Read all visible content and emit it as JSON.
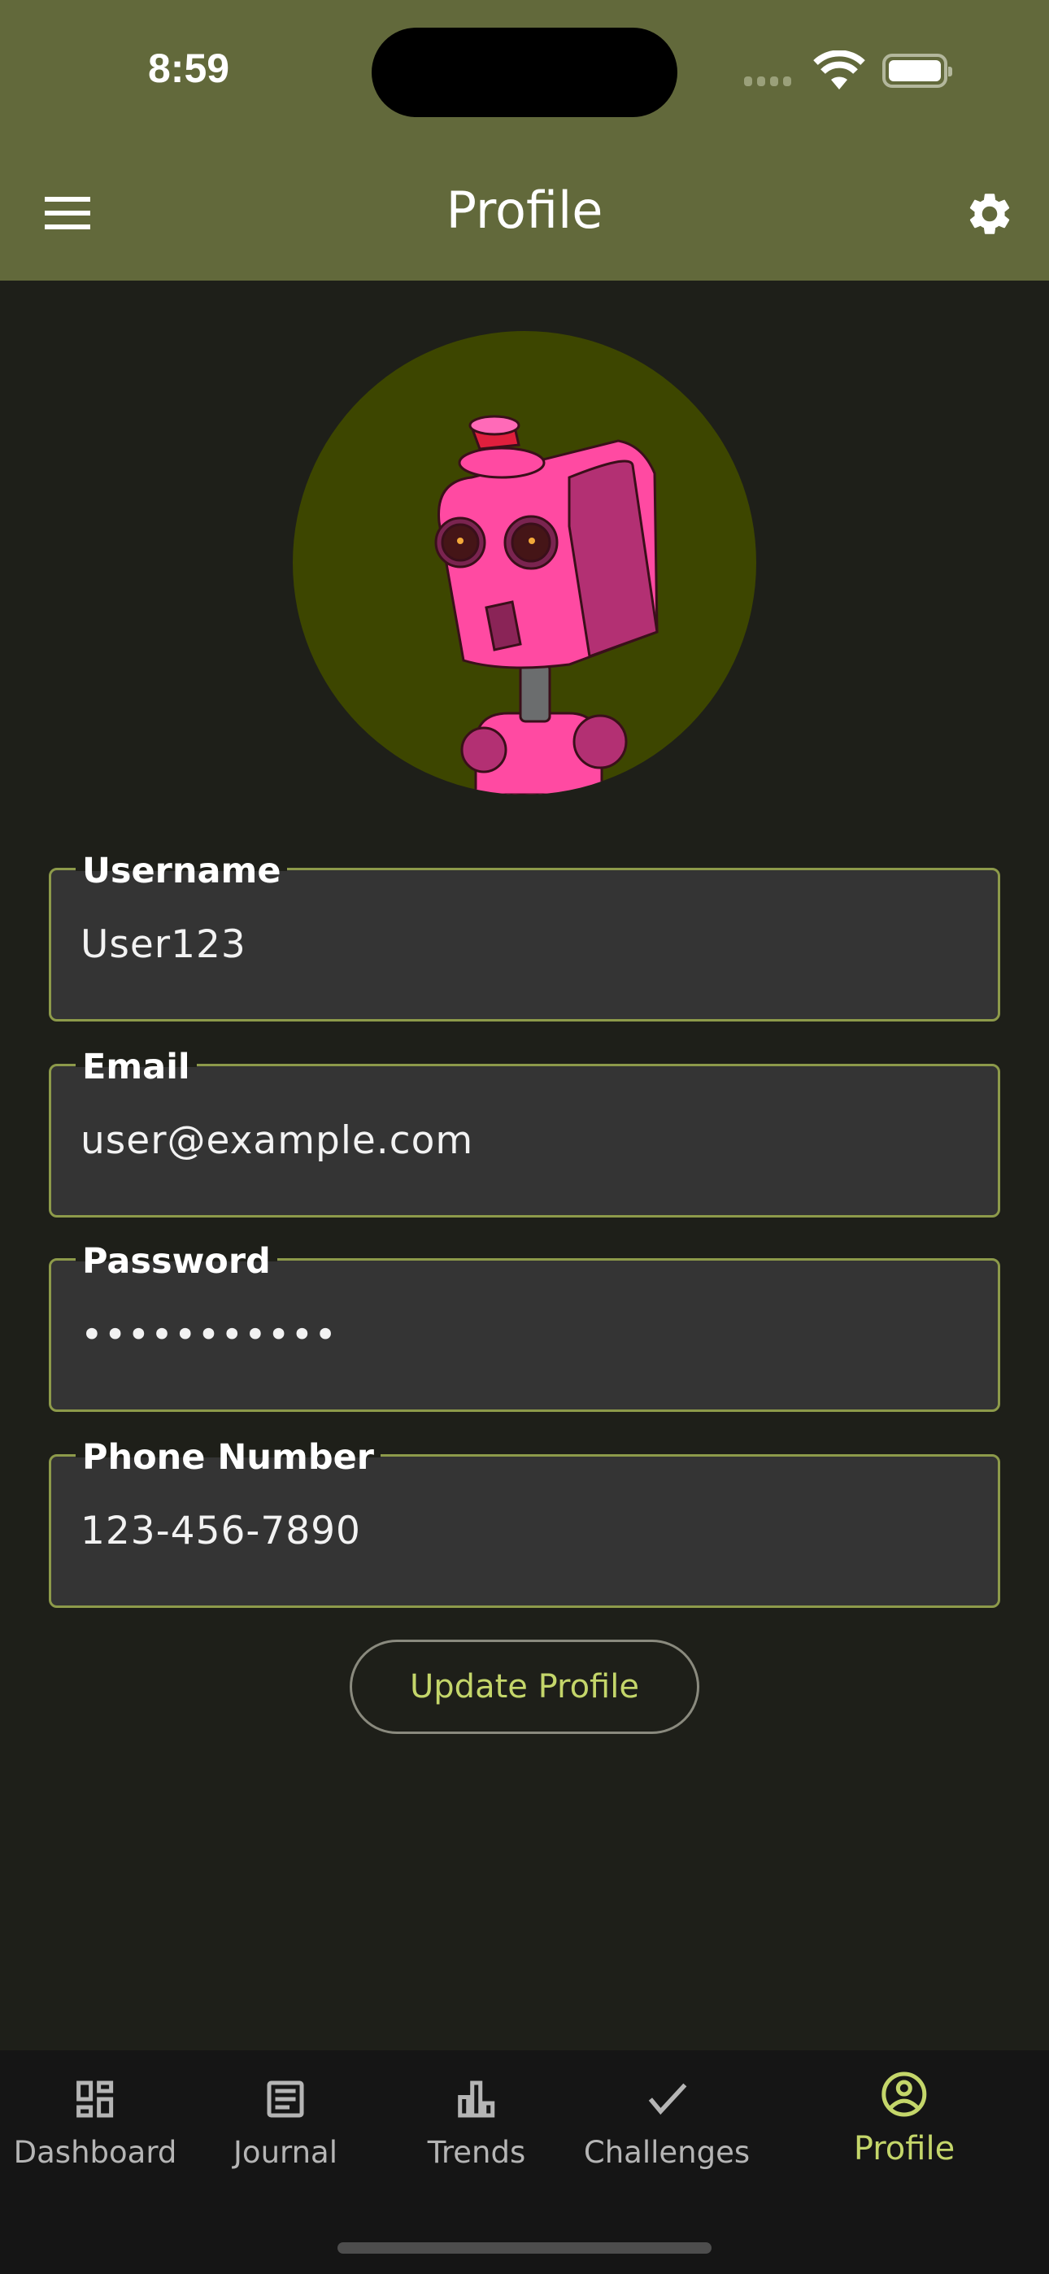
{
  "status_bar": {
    "time": "8:59"
  },
  "header": {
    "title": "Profile",
    "menu_icon": "hamburger-icon",
    "settings_icon": "gear-icon"
  },
  "avatar": {
    "description_icon": "robot-avatar"
  },
  "form": {
    "fields": [
      {
        "label": "Username",
        "value": "User123"
      },
      {
        "label": "Email",
        "value": "user@example.com"
      },
      {
        "label": "Password",
        "value": "•••••••••••"
      },
      {
        "label": "Phone Number",
        "value": "123-456-7890"
      }
    ],
    "submit_label": "Update Profile"
  },
  "nav": {
    "items": [
      {
        "label": "Dashboard",
        "icon": "dashboard-icon"
      },
      {
        "label": "Journal",
        "icon": "journal-icon"
      },
      {
        "label": "Trends",
        "icon": "bar-chart-icon"
      },
      {
        "label": "Challenges",
        "icon": "check-icon"
      },
      {
        "label": "Profile",
        "icon": "account-circle-icon",
        "active": true
      }
    ]
  },
  "colors": {
    "header": "#62693b",
    "background": "#1e1f19",
    "accent": "#c4d66a",
    "field_border": "#8d9a4a",
    "field_bg": "#343434",
    "avatar_bg": "#3d4600"
  }
}
